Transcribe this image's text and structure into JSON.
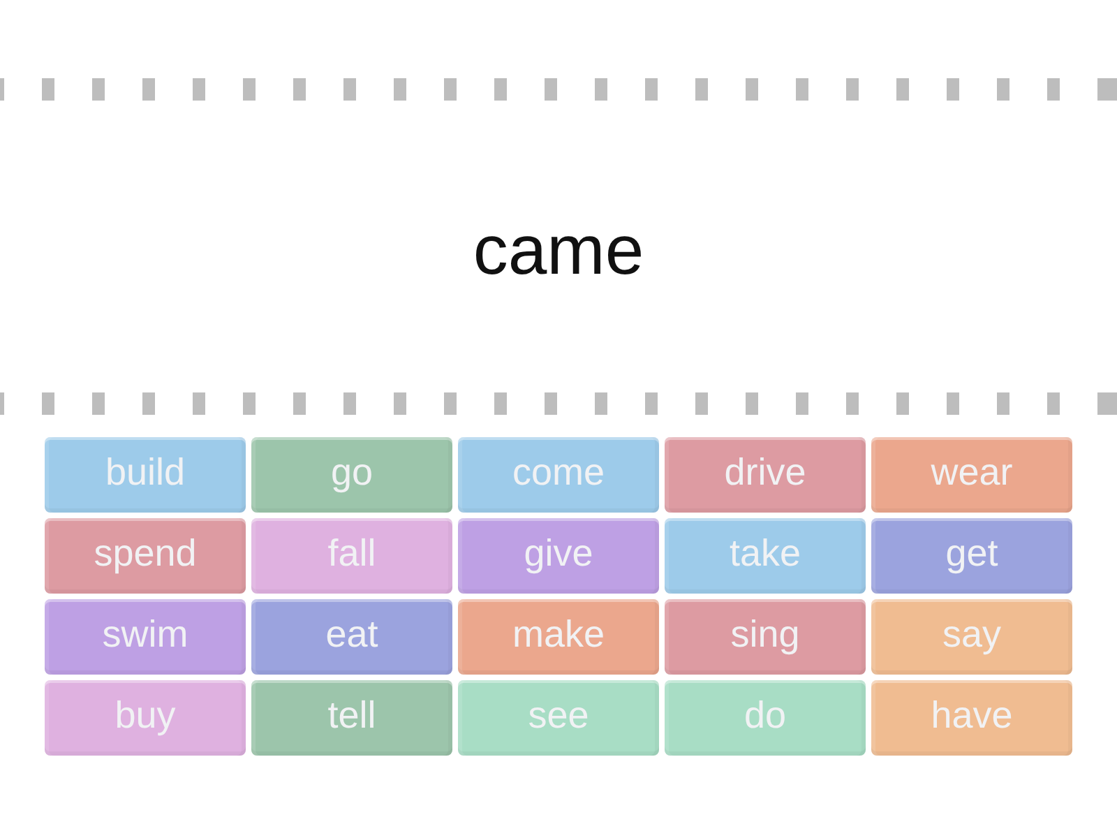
{
  "prompt": "came",
  "tiles": [
    {
      "label": "build",
      "color": "#9dcbea"
    },
    {
      "label": "go",
      "color": "#9cc5ab"
    },
    {
      "label": "come",
      "color": "#9dcbea"
    },
    {
      "label": "drive",
      "color": "#dd9ba2"
    },
    {
      "label": "wear",
      "color": "#eba78d"
    },
    {
      "label": "spend",
      "color": "#dd9ba2"
    },
    {
      "label": "fall",
      "color": "#dfb1e0"
    },
    {
      "label": "give",
      "color": "#bea0e4"
    },
    {
      "label": "take",
      "color": "#9dcbea"
    },
    {
      "label": "get",
      "color": "#9ba3de"
    },
    {
      "label": "swim",
      "color": "#bea0e4"
    },
    {
      "label": "eat",
      "color": "#9ba3de"
    },
    {
      "label": "make",
      "color": "#eba78d"
    },
    {
      "label": "sing",
      "color": "#dd9ba2"
    },
    {
      "label": "say",
      "color": "#f0bc91"
    },
    {
      "label": "buy",
      "color": "#dfb1e0"
    },
    {
      "label": "tell",
      "color": "#9cc5ab"
    },
    {
      "label": "see",
      "color": "#a8ddc5"
    },
    {
      "label": "do",
      "color": "#a8ddc5"
    },
    {
      "label": "have",
      "color": "#f0bc91"
    }
  ]
}
